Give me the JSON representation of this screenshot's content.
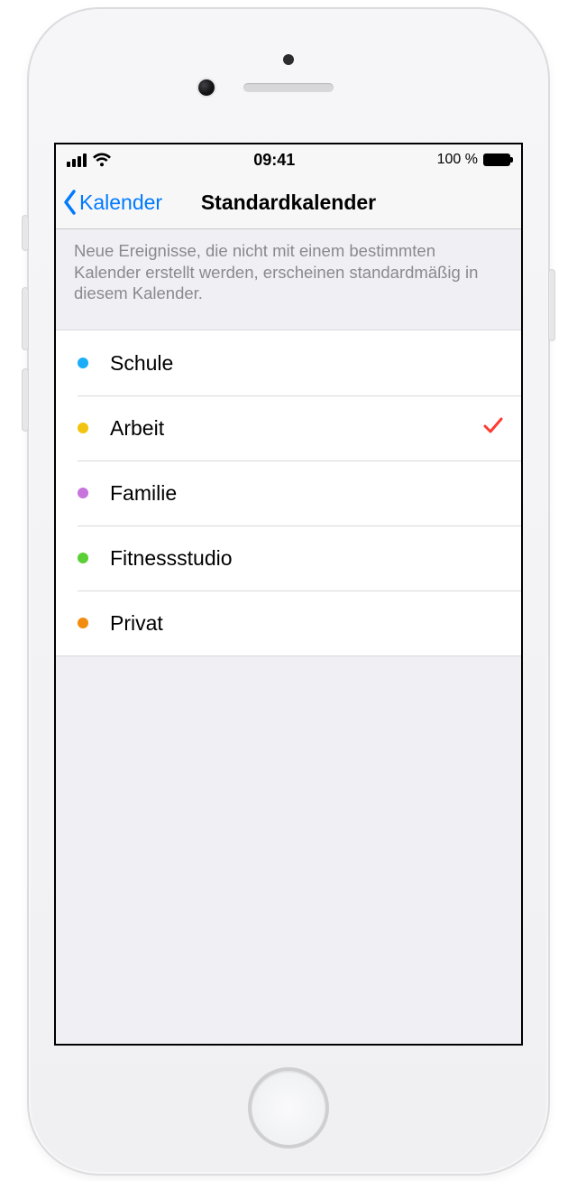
{
  "status_bar": {
    "time": "09:41",
    "battery_text": "100 %"
  },
  "nav": {
    "back_label": "Kalender",
    "title": "Standardkalender"
  },
  "description": "Neue Ereignisse, die nicht mit einem bestimmten Kalender erstellt werden, erscheinen standardmäßig in diesem Kalender.",
  "calendars": [
    {
      "label": "Schule",
      "color": "#1badf8",
      "selected": false
    },
    {
      "label": "Arbeit",
      "color": "#f2c40f",
      "selected": true
    },
    {
      "label": "Familie",
      "color": "#c774dc",
      "selected": false
    },
    {
      "label": "Fitnessstudio",
      "color": "#5bcf36",
      "selected": false
    },
    {
      "label": "Privat",
      "color": "#f28c0f",
      "selected": false
    }
  ]
}
